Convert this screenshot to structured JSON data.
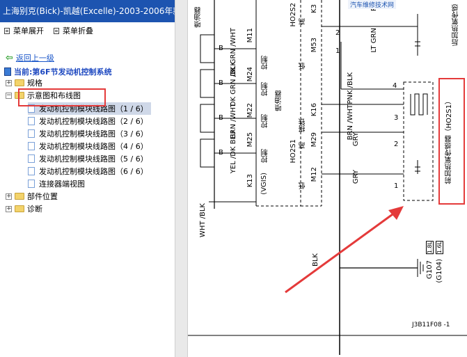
{
  "window": {
    "title": "上海别克(Bick)-凯越(Excelle)-2003-2006年款"
  },
  "toolbar": {
    "expand_label": "菜单展开",
    "collapse_label": "菜单折叠"
  },
  "nav": {
    "back_label": "返回上一级",
    "current_label": "当前:第6F节发动机控制系统"
  },
  "tree": {
    "items": [
      {
        "label": "规格"
      },
      {
        "label": "示意图和布线图"
      },
      {
        "label": "发动机控制模块线路图（1 / 6）"
      },
      {
        "label": "发动机控制模块线路图（2 / 6）"
      },
      {
        "label": "发动机控制模块线路图（3 / 6）"
      },
      {
        "label": "发动机控制模块线路图（4 / 6）"
      },
      {
        "label": "发动机控制模块线路图（5 / 6）"
      },
      {
        "label": "发动机控制模块线路图（6 / 6）"
      },
      {
        "label": "连接器端视图"
      },
      {
        "label": "部件位置"
      },
      {
        "label": "诊断"
      }
    ]
  },
  "diagram": {
    "labels": {
      "penyouqi_top": "喷油器",
      "k3": "K3",
      "ho2s2": "HO2S2",
      "gao1": "高",
      "di1": "低",
      "m53": "M53",
      "pp": "PP",
      "lt_grn": "LT GRN",
      "rear_sensor": "后加热氧传感",
      "b1": "B",
      "b2": "B",
      "b3": "B",
      "b4": "B",
      "dk_grn_wht": "DK GRN /WHT",
      "dk_grn_blk": "DK GRN /BLK",
      "brn_wht1": "BRN /WHT",
      "yel_dkblu": "YEL /DK BLU",
      "m11": "M11",
      "m24": "M24",
      "m22": "M22",
      "m25": "M25",
      "kongzhi1": "控制",
      "kongzhi2": "控制",
      "kongzhi3": "控制",
      "kongzhi4": "控制",
      "penyouqi_mid": "喷油器",
      "pnk_blk": "PNK /BLK",
      "brn_wht2": "BRN /WHT",
      "gry1": "GRY",
      "gry2": "GRY",
      "k16": "K16",
      "dati": "搭铁",
      "m29": "M29",
      "ho2s1": "HO2S1",
      "gao2": "高",
      "di2": "低",
      "m12": "M12",
      "k13": "K13",
      "vgis": "(VGIS)",
      "kongzhi5": "控制",
      "front_sensor": "前加热氧传感器（HO2S1）",
      "wht_blk": "WHT /BLK",
      "blk": "BLK",
      "g107": "G107",
      "g104": "(G104)",
      "size1": "1.8L",
      "size2": "1.6L",
      "code": "J3B11F08 -1",
      "pin4": "4",
      "pin3": "3",
      "pin2": "2",
      "pin1": "1",
      "pin2b": "2",
      "pin1b": "1",
      "banner": "汽车维修技术网"
    },
    "colors": {
      "annotation": "#e43a3a",
      "title_blue": "#1d54b0"
    }
  }
}
